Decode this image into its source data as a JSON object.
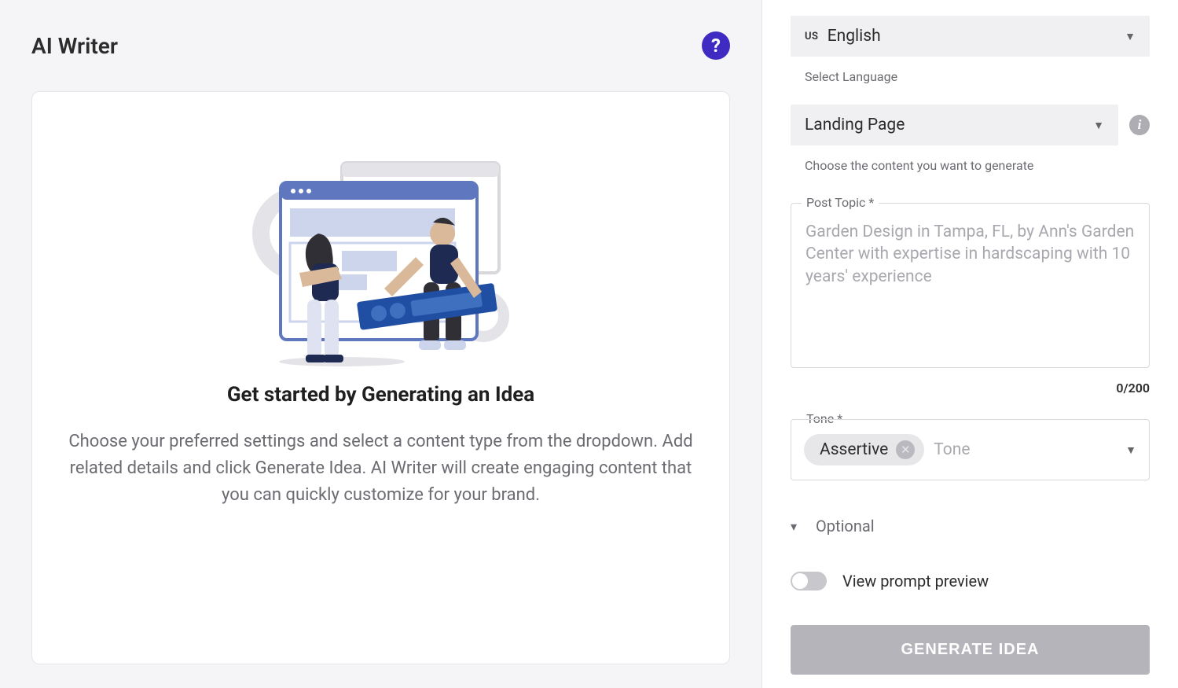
{
  "header": {
    "title": "AI Writer"
  },
  "card": {
    "heading": "Get started by Generating an Idea",
    "text": "Choose your preferred settings and select a content type from the dropdown. Add related details and click Generate Idea. AI Writer will create engaging content that you can quickly customize for your brand."
  },
  "sidebar": {
    "language": {
      "prefix": "US",
      "value": "English",
      "label": "Select Language"
    },
    "content_type": {
      "value": "Landing Page",
      "label": "Choose the content you want to generate"
    },
    "post_topic": {
      "legend": "Post Topic *",
      "placeholder": "Garden Design in Tampa, FL, by Ann's Garden Center with expertise in hardscaping with 10 years' experience",
      "counter": "0/200"
    },
    "tone": {
      "legend": "Tone *",
      "chip": "Assertive",
      "placeholder": "Tone"
    },
    "optional_label": "Optional",
    "prompt_preview_label": "View prompt preview",
    "generate_button": "GENERATE IDEA"
  }
}
